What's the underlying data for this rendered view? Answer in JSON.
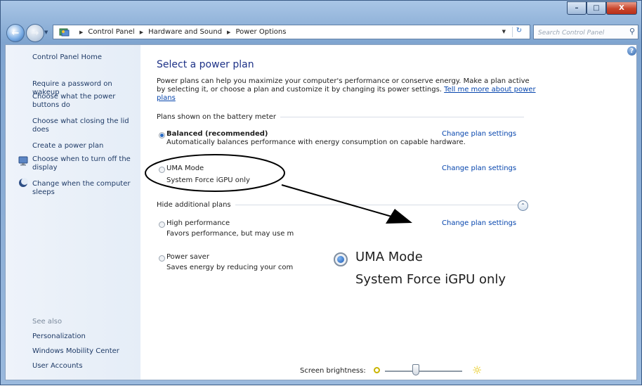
{
  "window": {
    "minimize_glyph": "–",
    "maximize_glyph": "□",
    "close_glyph": "X"
  },
  "nav": {
    "back_glyph": "←",
    "forward_glyph": "→",
    "breadcrumbs": [
      "Control Panel",
      "Hardware and Sound",
      "Power Options"
    ],
    "search_placeholder": "Search Control Panel"
  },
  "sidebar": {
    "home": "Control Panel Home",
    "links": [
      "Require a password on wakeup",
      "Choose what the power buttons do",
      "Choose what closing the lid does",
      "Create a power plan",
      "Choose when to turn off the display",
      "Change when the computer sleeps"
    ],
    "see_also_label": "See also",
    "see_also": [
      "Personalization",
      "Windows Mobility Center",
      "User Accounts"
    ]
  },
  "main": {
    "help_glyph": "?",
    "title": "Select a power plan",
    "description": "Power plans can help you maximize your computer's performance or conserve energy. Make a plan active by selecting it, or choose a plan and customize it by changing its power settings.",
    "description_link": "Tell me more about power plans",
    "battery_group": "Plans shown on the battery meter",
    "additional_group": "Hide additional plans",
    "change_link": "Change plan settings",
    "plans": [
      {
        "name": "Balanced (recommended)",
        "desc": "Automatically balances performance with energy consumption on capable hardware.",
        "selected": true
      },
      {
        "name": "UMA Mode",
        "desc": "System Force iGPU only",
        "selected": false
      },
      {
        "name": "High performance",
        "desc": "Favors performance, but may use m",
        "selected": false
      },
      {
        "name": "Power saver",
        "desc": "Saves energy by reducing your com",
        "selected": false
      }
    ],
    "brightness_label": "Screen brightness:",
    "brightness_level": 0.4
  },
  "zoom_callout": {
    "name": "UMA Mode",
    "desc": "System Force iGPU only"
  }
}
